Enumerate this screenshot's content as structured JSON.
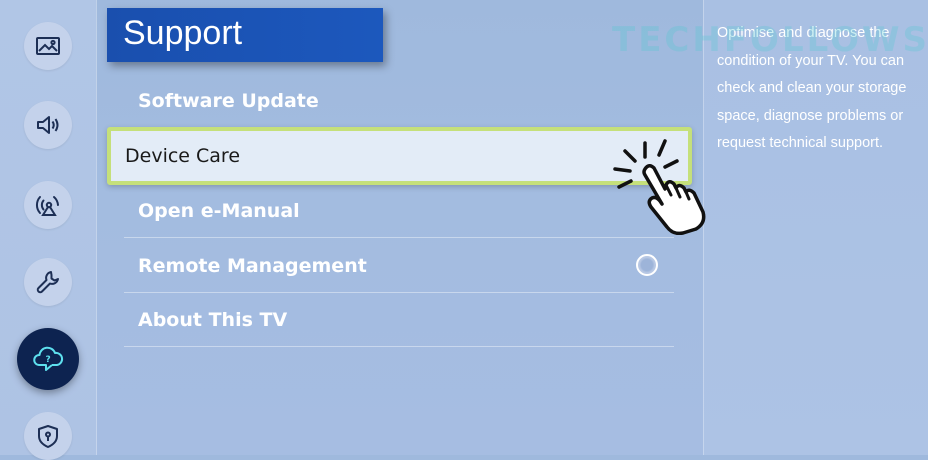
{
  "sidebar": {
    "items": [
      {
        "icon": "picture-icon",
        "active": false
      },
      {
        "icon": "sound-icon",
        "active": false
      },
      {
        "icon": "broadcast-icon",
        "active": false
      },
      {
        "icon": "wrench-icon",
        "active": false
      },
      {
        "icon": "support-cloud-icon",
        "active": true
      },
      {
        "icon": "shield-icon",
        "active": false
      }
    ]
  },
  "header": {
    "title": "Support"
  },
  "menu": {
    "items": [
      {
        "label": "Software Update"
      },
      {
        "label": "Device Care",
        "selected": true
      },
      {
        "label": "Open e-Manual"
      },
      {
        "label": "Remote Management",
        "has_radio": true
      },
      {
        "label": "About This TV"
      }
    ]
  },
  "description": {
    "text": "Optimise and diagnose the condition of your TV. You can check and clean your storage space, diagnose problems or request technical support."
  },
  "watermark": {
    "text": "TECHFOLLOWS"
  },
  "colors": {
    "title_bg": "#1c58bd",
    "selection_border": "#c5e07a",
    "active_icon_bg": "#0d2350",
    "icon_stroke": "#1d2f55"
  }
}
